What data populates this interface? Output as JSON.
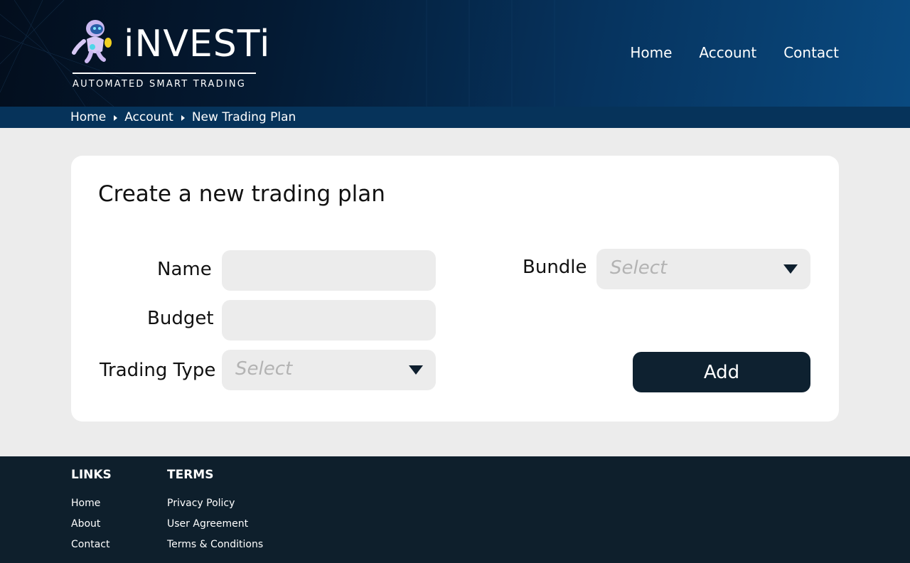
{
  "header": {
    "brand": "iNVESTi",
    "tagline": "AUTOMATED SMART TRADING",
    "nav": [
      "Home",
      "Account",
      "Contact"
    ]
  },
  "breadcrumb": [
    "Home",
    "Account",
    "New Trading Plan"
  ],
  "form": {
    "title": "Create a new trading plan",
    "name": {
      "label": "Name",
      "value": ""
    },
    "budget": {
      "label": "Budget",
      "value": ""
    },
    "trading_type": {
      "label": "Trading Type",
      "selected": "Select"
    },
    "bundle": {
      "label": "Bundle",
      "selected": "Select"
    },
    "add_label": "Add"
  },
  "footer": {
    "links": {
      "heading": "LINKS",
      "items": [
        "Home",
        "About",
        "Contact"
      ]
    },
    "terms": {
      "heading": "TERMS",
      "items": [
        "Privacy Policy",
        "User Agreement",
        "Terms & Conditions"
      ]
    }
  },
  "colors": {
    "header_dark": "#030e1d",
    "header_light": "#0a4a80",
    "breadcrumb_bg": "#06335a",
    "button_bg": "#0e2130",
    "footer_bg": "#0e1f2c",
    "page_bg": "#ececec"
  },
  "icons": [
    "robot-mascot-logo",
    "breadcrumb-arrow-icon",
    "dropdown-caret-icon"
  ]
}
